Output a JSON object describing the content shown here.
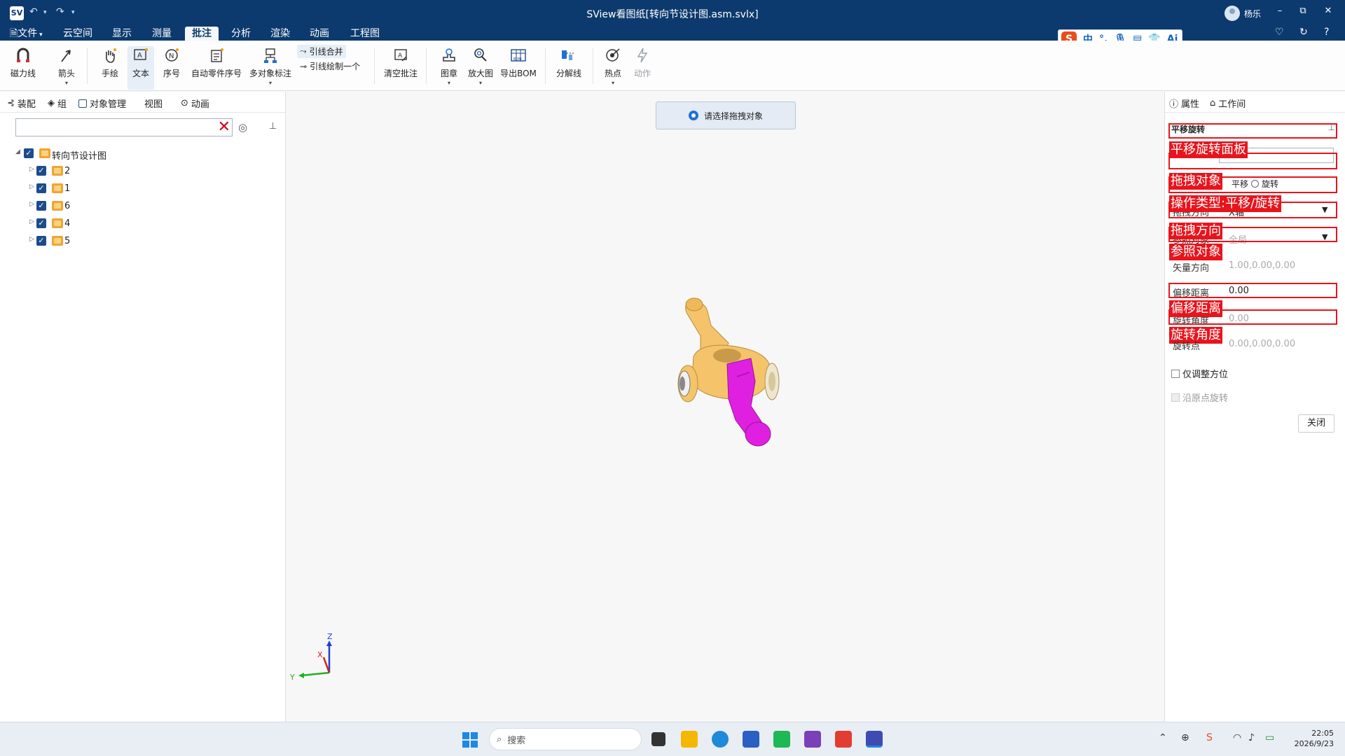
{
  "window": {
    "title": "SView看图纸[转向节设计图.asm.svlx]",
    "user_name": "杨乐",
    "minimize": "–",
    "restore": "⧉",
    "close": "✕"
  },
  "menubar": {
    "file": "文件",
    "items": [
      "云空间",
      "显示",
      "测量",
      "批注",
      "分析",
      "渲染",
      "动画",
      "工程图"
    ],
    "active": "批注"
  },
  "ime": {
    "logo": "S",
    "lang": "中",
    "punct": "°,",
    "ai": "Ai"
  },
  "ribbon": {
    "magnet_line": "磁力线",
    "arrow": "箭头",
    "freehand": "手绘",
    "text": "文本",
    "sequence": "序号",
    "auto_part_sequence": "自动零件序号",
    "multi_object_annotation": "多对象标注",
    "leader_merge": "引线合并",
    "leader_draw_one": "引线绘制一个",
    "clear_annotations": "清空批注",
    "stamp": "图章",
    "magnify": "放大图",
    "export_bom": "导出BOM",
    "explode_line": "分解线",
    "hotspot": "热点",
    "action": "动作",
    "tooltip": "文本"
  },
  "left_panel": {
    "tabs": [
      "装配",
      "组",
      "对象管理",
      "视图",
      "动画"
    ],
    "search_placeholder": "",
    "tree": {
      "root": "转向节设计图",
      "children": [
        "2",
        "1",
        "6",
        "4",
        "5"
      ]
    }
  },
  "viewport": {
    "hint": "请选择拖拽对象",
    "axes": {
      "z": "Z",
      "x": "X",
      "y": "Y"
    }
  },
  "right_panel": {
    "tabs": [
      "属性",
      "工作间"
    ],
    "panel_title": "平移旋转",
    "drag_options": [
      "平移",
      "旋转"
    ],
    "drag_direction_label": "拖拽方向",
    "drag_direction_value": "X轴",
    "reference_label": "参照对象",
    "reference_value": "全局",
    "vector_label": "矢量方向",
    "vector_value": "1.00,0.00,0.00",
    "offset_label": "偏移距离",
    "offset_value": "0.00",
    "rotate_angle_label": "旋转角度",
    "rotate_angle_value": "0.00",
    "rotate_point_label": "旋转点",
    "rotate_point_value": "0.00,0.00,0.00",
    "orient_only": "仅调整方位",
    "rotate_origin": "沿原点旋转",
    "close": "关闭",
    "annotations": [
      "平移旋转面板",
      "拖拽对象",
      "操作类型:平移/旋转",
      "拖拽方向",
      "参照对象",
      "偏移距离",
      "旋转角度"
    ]
  },
  "taskbar": {
    "search": "搜索",
    "time": "22:05",
    "date": "2026/9/23"
  },
  "colors": {
    "title_bg": "#0d3a6e",
    "annotation_red": "#e8141c",
    "part_yellow": "#f5c46a",
    "part_magenta": "#e020e0"
  }
}
